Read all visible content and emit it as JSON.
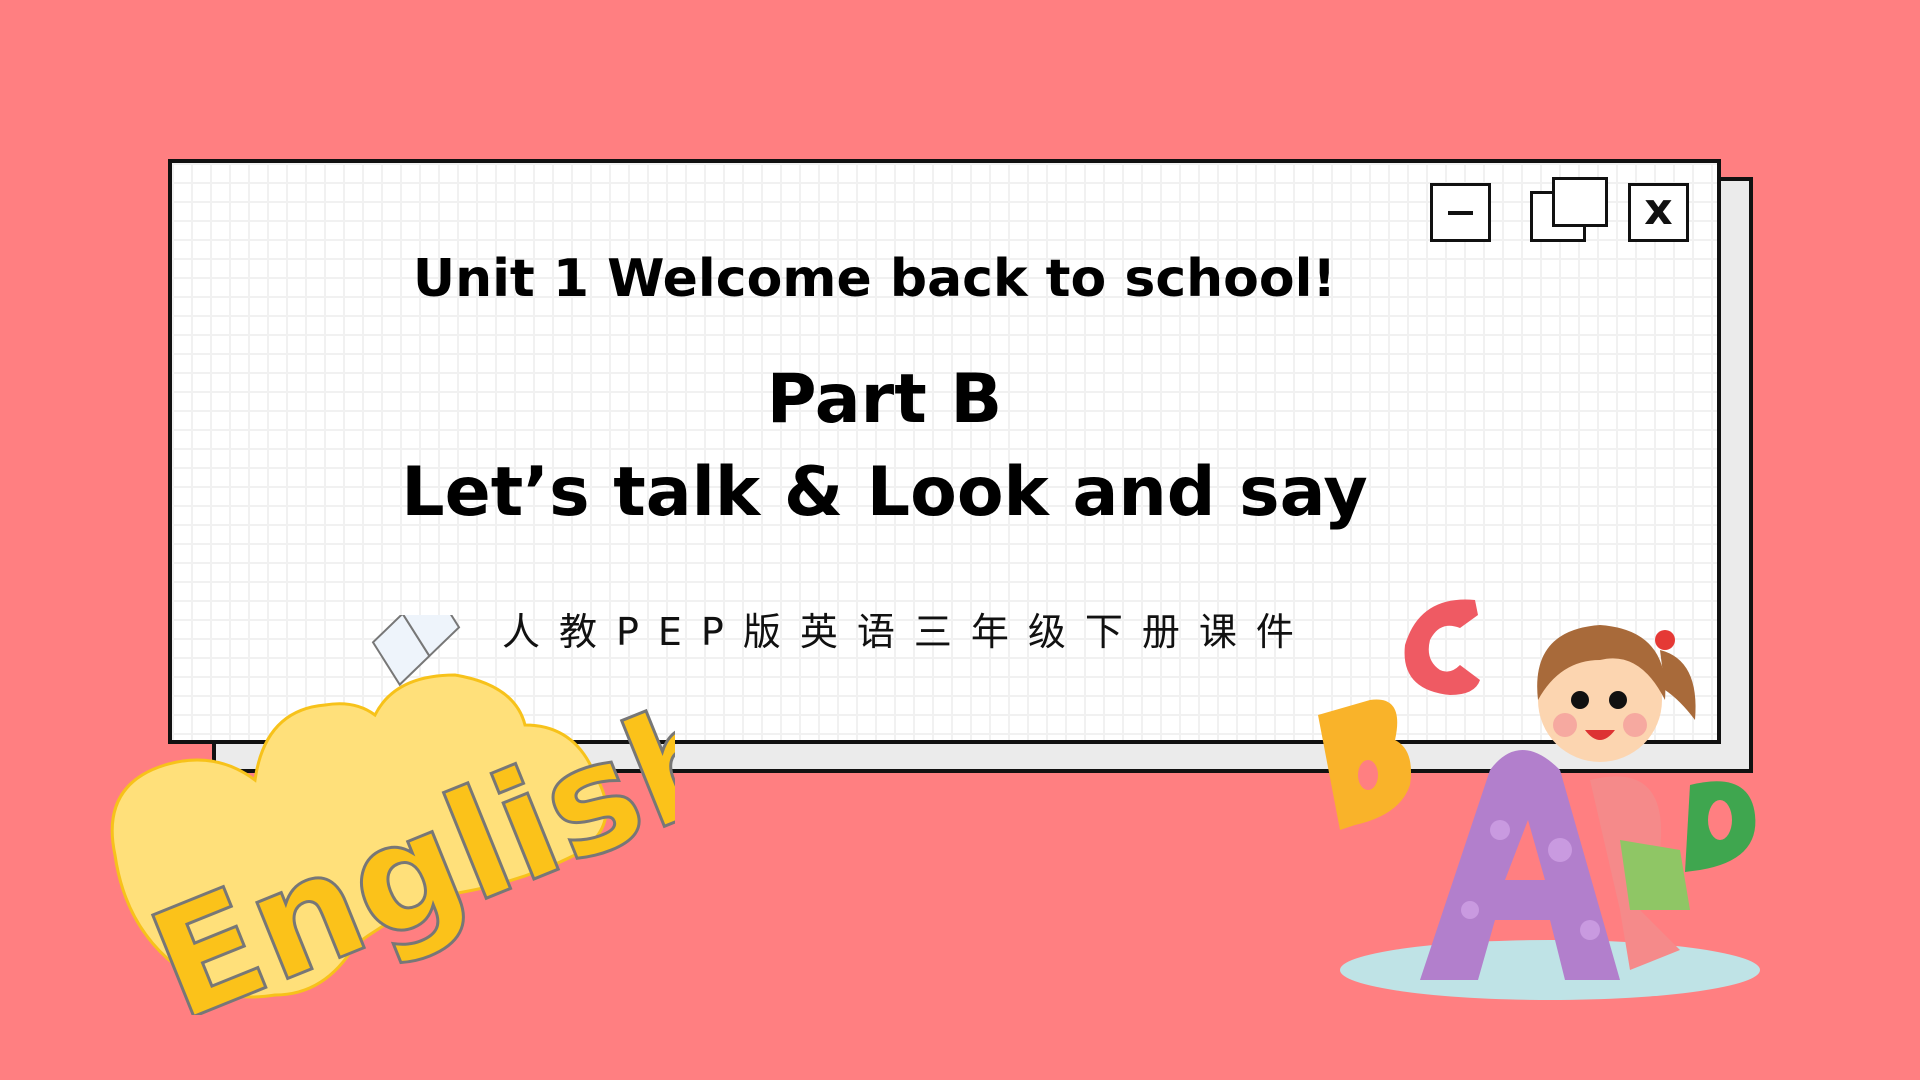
{
  "colors": {
    "background": "#ff7f81",
    "window_bg": "#ffffff",
    "window_border": "#111111",
    "shadow_box": "#ebebeb",
    "logo_yellow": "#fbc21a",
    "logo_light": "#ffe07a",
    "letter_a": "#b27fcc",
    "letter_b": "#f9b32a",
    "letter_c": "#ef5a63",
    "letter_d": "#3fa64f"
  },
  "window": {
    "controls": {
      "minimize": "minimize-icon",
      "restore": "restore-icon",
      "close_label": "x"
    }
  },
  "slide": {
    "unit_title": "Unit 1 Welcome back to school!",
    "part": "Part B",
    "lesson": "Let’s talk & Look and say",
    "subtitle": "人教PEP版英语三年级下册课件"
  },
  "decorations": {
    "logo_text": "English",
    "letters": [
      "A",
      "B",
      "C",
      "D"
    ]
  }
}
